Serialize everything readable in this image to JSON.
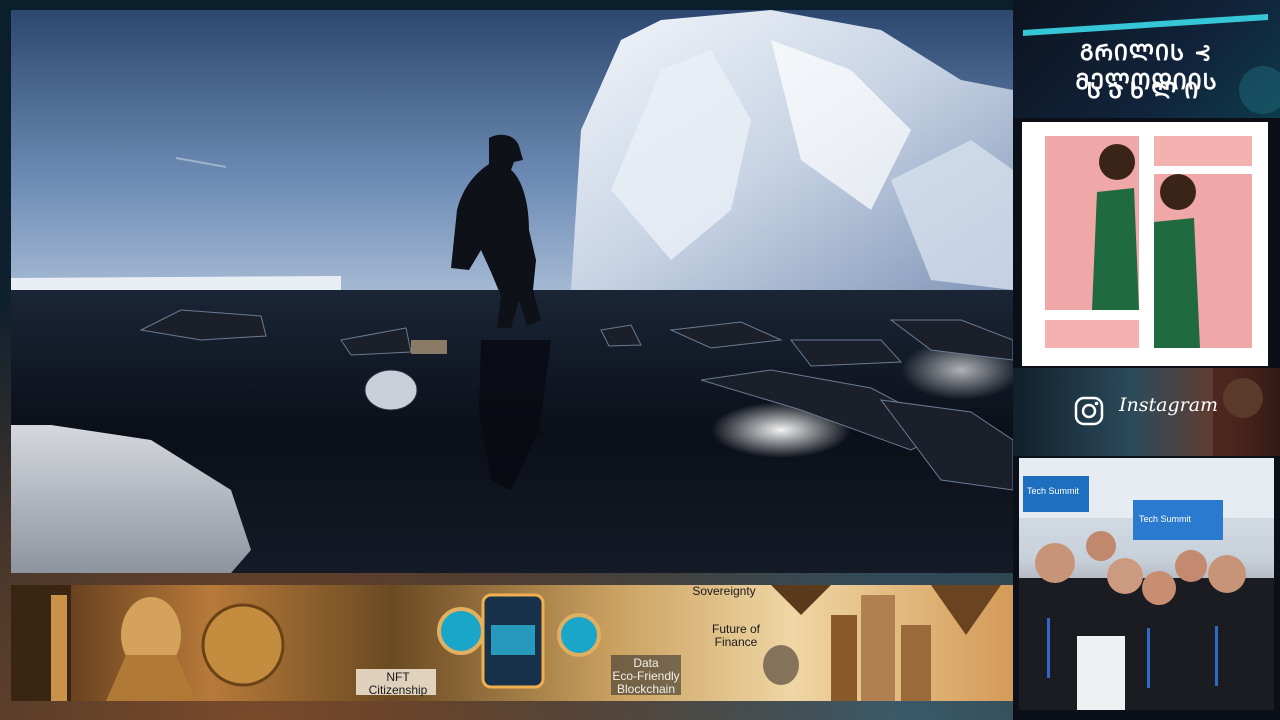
{
  "stream": {
    "channel_title_line1": "ᲒᲠᲘᲚᲘᲡ ⊰ ᲛᲔᲚᲝᲓᲘᲘᲡ",
    "channel_title_line2": "ᲡᲐᲮᲚᲘ",
    "instagram_label": "Instagram"
  },
  "banner": {
    "labels": [
      "Sovereignty",
      "Future of\nFinance",
      "NFT\nCitizenship",
      "Data\nEco-Friendly\nBlockchain"
    ]
  },
  "group_photo": {
    "booth_sign_left": "Tech Summit",
    "booth_sign_right": "Tech Summit"
  },
  "colors": {
    "accent_teal": "#35c7d8",
    "panel_bg": "#0a0f18",
    "photo_frame": "#ffffff",
    "pink_backdrop": "#f0a7a8",
    "jacket_green": "#1f6a3e"
  },
  "icons": [
    "instagram-icon"
  ]
}
